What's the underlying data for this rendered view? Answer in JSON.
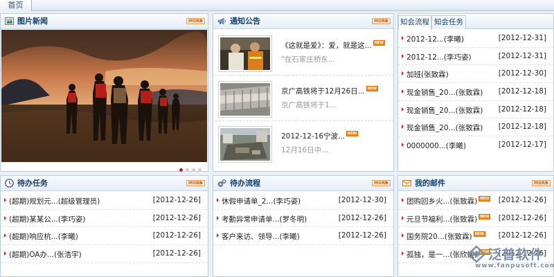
{
  "top_tab": "首页",
  "picture_news": {
    "title": "图片新闻",
    "more": "MORE",
    "slides": 4,
    "active_slide": 1
  },
  "notices": {
    "title": "通知公告",
    "more": "MORE",
    "new_badge": "NEW",
    "items": [
      {
        "title": "《这就是爱》：爱，就是这...",
        "summary": "\"在石家庄桥东..."
      },
      {
        "title": "京广高铁将于12月26日...",
        "summary": "京广高铁将于1..."
      },
      {
        "title": "2012-12-16宁波...",
        "summary": "12月16日中..."
      }
    ]
  },
  "knowledge": {
    "tabs": [
      "知会流程",
      "知会任务"
    ],
    "active_tab": 0,
    "rows": [
      {
        "text": "2012-12...(李曦)",
        "date": "[2012-12-31]"
      },
      {
        "text": "2012-12...(李巧姿)",
        "date": "[2012-12-31]"
      },
      {
        "text": "加班(张致霖)",
        "date": "[2012-12-30]"
      },
      {
        "text": "现金销售_20...(张致霖)",
        "date": "[2012-12-18]"
      },
      {
        "text": "现金销售_20...(张致霖)",
        "date": "[2012-12-18]"
      },
      {
        "text": "现金销售_20...(张致霖)",
        "date": "[2012-12-18]"
      },
      {
        "text": "0000000...(李曦)",
        "date": "[2012-12-17]"
      }
    ]
  },
  "todo_tasks": {
    "title": "待办任务",
    "more": "MORE",
    "rows": [
      {
        "text": "(超期)规划元...(超级管理员)",
        "date": "[2012-12-26]"
      },
      {
        "text": "(超期)某某公...(李巧姿)",
        "date": "[2012-12-26]"
      },
      {
        "text": "(超期)响应杭...(李曦)",
        "date": "[2012-12-26]"
      },
      {
        "text": "(超期)OA办...(张浩宇)",
        "date": "[2012-12-26]"
      }
    ]
  },
  "todo_flows": {
    "title": "待办流程",
    "more": "MORE",
    "rows": [
      {
        "text": "休假申请单_2...(李巧姿)",
        "date": "[2012-12-30]"
      },
      {
        "text": "考勤异常申请单...(罗冬明)",
        "date": "[2012-12-26]"
      },
      {
        "text": "客户来访、领导...(李曦)",
        "date": "[2012-12-26]"
      }
    ]
  },
  "mail": {
    "title": "我的邮件",
    "more": "MORE",
    "rows": [
      {
        "text": "团购回乡火...(张致霖)",
        "new": true,
        "date": "[2012-12-26]"
      },
      {
        "text": "元旦节福利...(张致霖)",
        "new": true,
        "date": "[2012-12-26]"
      },
      {
        "text": "国务院20...(张致霖)",
        "new": true,
        "date": "[2012-12-26]"
      },
      {
        "text": "孤独，是一...(张欣媛)",
        "new": true,
        "date": "[2012-12-26]"
      }
    ]
  },
  "watermark": {
    "brand": "泛普软件",
    "url": "www.fanpusoft.com"
  }
}
